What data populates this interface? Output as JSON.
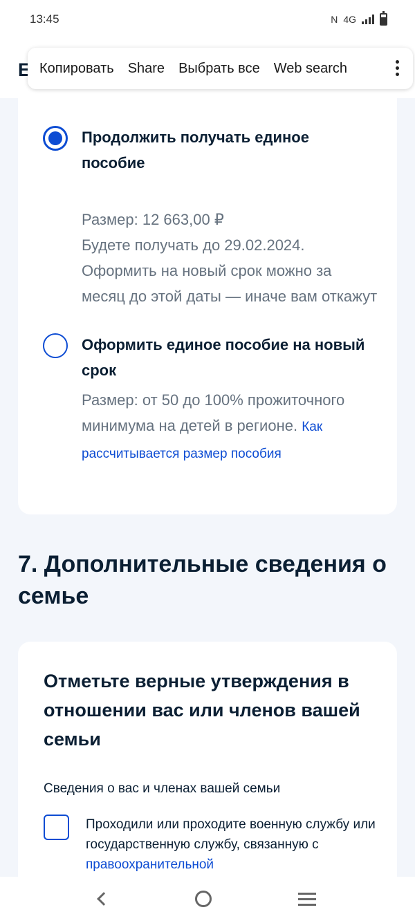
{
  "status_bar": {
    "time": "13:45",
    "network": "4G"
  },
  "header": {
    "partial_title": "E"
  },
  "context_menu": {
    "items": [
      "Копировать",
      "Share",
      "Выбрать все",
      "Web search"
    ]
  },
  "options": [
    {
      "title": "Продолжить получать единое пособие",
      "selected": true,
      "lines": [
        "Размер: 12 663,00 ₽",
        "Будете получать до 29.02.2024.",
        "Оформить на новый срок можно за месяц до этой даты — иначе вам откажут"
      ]
    },
    {
      "title": "Оформить единое пособие на новый срок",
      "selected": false,
      "text": "Размер: от 50 до 100% прожиточного минимума на детей в регионе.",
      "link": "Как рассчитывается размер пособия"
    }
  ],
  "section": {
    "heading": "7. Дополнительные сведения о семье"
  },
  "family_card": {
    "title": "Отметьте верные утверждения в отношении вас или членов вашей семьи",
    "subtitle": "Сведения о вас и членах вашей семьи",
    "checkbox_text": "Проходили или проходите военную службу или государственную службу, связанную с",
    "checkbox_link": "правоохранительной"
  },
  "colors": {
    "accent": "#0d4cd3",
    "text": "#0b1f33",
    "muted": "#66727f",
    "background": "#f3f6fb"
  }
}
